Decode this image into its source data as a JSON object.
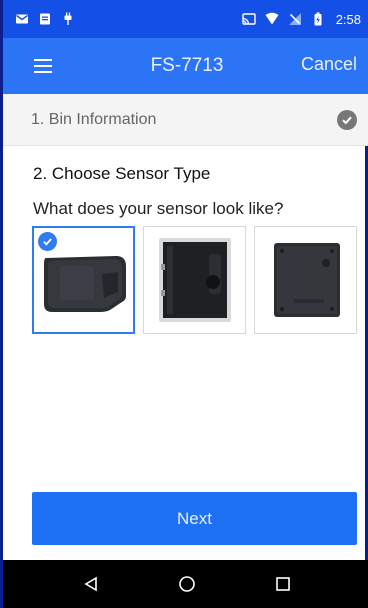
{
  "status_bar": {
    "time": "2:58",
    "left_icons": [
      "mail-icon",
      "document-icon",
      "android-icon"
    ],
    "right_icons": [
      "cast-icon",
      "wifi-icon",
      "signal-icon",
      "battery-charging-icon"
    ]
  },
  "app_bar": {
    "title": "FS-7713",
    "cancel_label": "Cancel",
    "menu_icon": "hamburger-menu-icon"
  },
  "sections": {
    "bin_information": {
      "label": "1. Bin Information",
      "completed": true
    },
    "sensor_type": {
      "title": "2. Choose Sensor Type",
      "question": "What does your sensor look like?",
      "selected_index": 0
    }
  },
  "next_button": {
    "label": "Next"
  },
  "colors": {
    "status_bar": "#1550e6",
    "app_bar": "#2b74f5",
    "accent": "#1d71f2",
    "selection": "#2f7bf2"
  }
}
